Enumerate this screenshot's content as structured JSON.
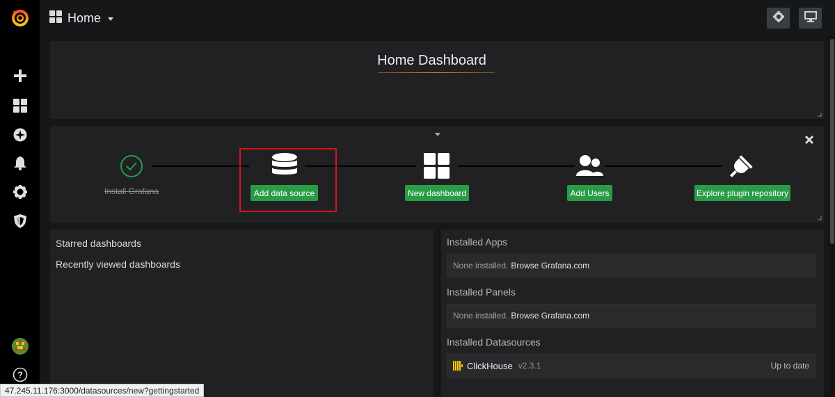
{
  "topbar": {
    "home_label": "Home"
  },
  "dashboard": {
    "title": "Home Dashboard"
  },
  "getting_started": {
    "steps": [
      {
        "label": "Install Grafana",
        "done": true
      },
      {
        "label": "Add data source",
        "done": false
      },
      {
        "label": "New dashboard",
        "done": false
      },
      {
        "label": "Add Users",
        "done": false
      },
      {
        "label": "Explore plugin repository",
        "done": false
      }
    ]
  },
  "left_panel": {
    "starred": "Starred dashboards",
    "recent": "Recently viewed dashboards"
  },
  "right_panel": {
    "apps_heading": "Installed Apps",
    "apps_none": "None installed.",
    "apps_browse": "Browse Grafana.com",
    "panels_heading": "Installed Panels",
    "panels_none": "None installed.",
    "panels_browse": "Browse Grafana.com",
    "datasources_heading": "Installed Datasources",
    "datasource": {
      "name": "ClickHouse",
      "version": "v2.3.1",
      "status": "Up to date"
    }
  },
  "status_bar": {
    "url": "47.245.11.176:3000/datasources/new?gettingstarted"
  },
  "colors": {
    "accent_green": "#299c46",
    "highlight_red": "#d1151f",
    "brand_orange": "#eb7b18"
  }
}
